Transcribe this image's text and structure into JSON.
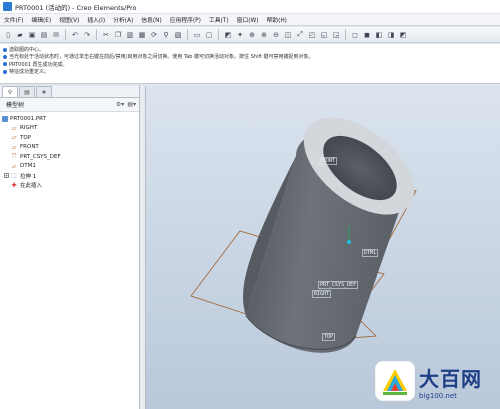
{
  "window": {
    "title": "PRT0001 (活动的) - Creo Elements/Pro"
  },
  "menu": [
    "文件(F)",
    "编辑(E)",
    "视图(V)",
    "插入(I)",
    "分析(A)",
    "信息(N)",
    "应用程序(P)",
    "工具(T)",
    "窗口(W)",
    "帮助(H)"
  ],
  "messages": [
    "选取图的中心。",
    "当光标处于活动状态时，可通过单击右键在前后/禁用/启用对象之间切换。使用 Tab 键可切换活动对象。按住 Shift 键可禁用捕捉到对象。",
    "PRT0001 再生成功完成。",
    "特征成功重定义。"
  ],
  "panel": {
    "tree_header": "模型树",
    "items": [
      {
        "label": "PRT0001.PRT",
        "icon": "part-icon",
        "level": 0
      },
      {
        "label": "RIGHT",
        "icon": "datum-plane-icon",
        "level": 1
      },
      {
        "label": "TOP",
        "icon": "datum-plane-icon",
        "level": 1
      },
      {
        "label": "FRONT",
        "icon": "datum-plane-icon",
        "level": 1
      },
      {
        "label": "PRT_CSYS_DEF",
        "icon": "csys-icon",
        "level": 1
      },
      {
        "label": "DTM1",
        "icon": "datum-plane-icon",
        "level": 1
      },
      {
        "label": "拉伸 1",
        "icon": "extrude-icon",
        "level": 1,
        "expandable": true
      },
      {
        "label": "在此插入",
        "icon": "insert-here-icon",
        "level": 1
      }
    ]
  },
  "viewport": {
    "labels": {
      "front": "FRONT",
      "dtm1": "DTM1",
      "csys": "PRT_CSYS_DEF",
      "right": "RIGHT",
      "top": "TOP"
    }
  },
  "watermark": {
    "big": "大百网",
    "small": "big100.net"
  },
  "colors": {
    "viewport_top": "#dbe4ef",
    "viewport_bottom": "#b9c8da",
    "part": "#6b7078",
    "datum": "#a0602a"
  }
}
